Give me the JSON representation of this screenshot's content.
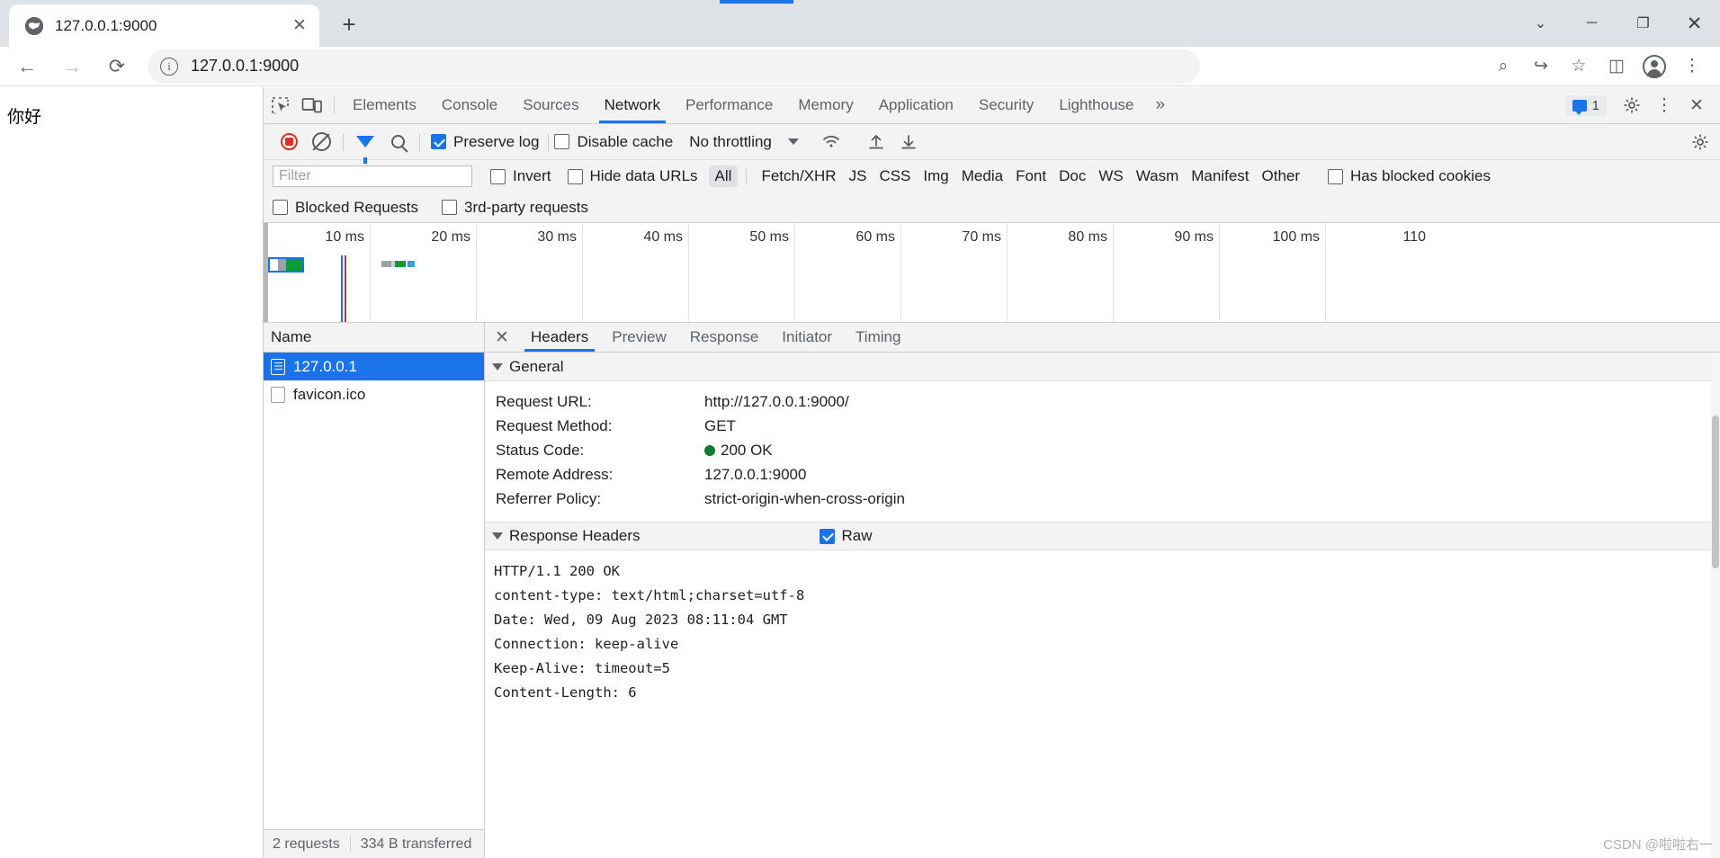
{
  "browser": {
    "tab": {
      "title": "127.0.0.1:9000",
      "favicon": "globe-icon",
      "close": "✕"
    },
    "new_tab": "+",
    "window_controls": {
      "expand": "⌄",
      "minimize": "─",
      "maximize": "❐",
      "close": "✕"
    },
    "nav": {
      "back": "←",
      "forward": "→",
      "reload": "⟳"
    },
    "omnibox": {
      "info": "i",
      "url": "127.0.0.1:9000"
    },
    "toolbar_right": {
      "zoom": "⌕",
      "share": "↪",
      "bookmark": "☆",
      "sidepanel": "◫",
      "menu": "⋮"
    }
  },
  "page": {
    "body_text": "你好"
  },
  "devtools": {
    "header": {
      "inspect_icon": "inspect-element-icon",
      "device_icon": "device-toolbar-icon",
      "tabs": [
        {
          "label": "Elements",
          "active": false
        },
        {
          "label": "Console",
          "active": false
        },
        {
          "label": "Sources",
          "active": false
        },
        {
          "label": "Network",
          "active": true
        },
        {
          "label": "Performance",
          "active": false
        },
        {
          "label": "Memory",
          "active": false
        },
        {
          "label": "Application",
          "active": false
        },
        {
          "label": "Security",
          "active": false
        },
        {
          "label": "Lighthouse",
          "active": false
        }
      ],
      "more": "»",
      "message_count": "1",
      "settings_icon": "gear-icon",
      "menu_icon": "kebab-menu-icon",
      "close_icon": "close-icon"
    },
    "toolbar": {
      "record_label": "record-button",
      "clear_label": "clear-button",
      "filter_label": "filter-toggle",
      "search_label": "search-button",
      "preserve_log": {
        "label": "Preserve log",
        "checked": true
      },
      "disable_cache": {
        "label": "Disable cache",
        "checked": false
      },
      "throttling": "No throttling",
      "wifi_icon": "network-conditions-icon",
      "import_icon": "import-har-icon",
      "export_icon": "export-har-icon",
      "settings_icon": "network-settings-icon"
    },
    "filterbar": {
      "filter_placeholder": "Filter",
      "filter_value": "",
      "invert": {
        "label": "Invert",
        "checked": false
      },
      "hide_data_urls": {
        "label": "Hide data URLs",
        "checked": false
      },
      "types": [
        {
          "label": "All",
          "active": true
        },
        {
          "label": "Fetch/XHR",
          "active": false
        },
        {
          "label": "JS",
          "active": false
        },
        {
          "label": "CSS",
          "active": false
        },
        {
          "label": "Img",
          "active": false
        },
        {
          "label": "Media",
          "active": false
        },
        {
          "label": "Font",
          "active": false
        },
        {
          "label": "Doc",
          "active": false
        },
        {
          "label": "WS",
          "active": false
        },
        {
          "label": "Wasm",
          "active": false
        },
        {
          "label": "Manifest",
          "active": false
        },
        {
          "label": "Other",
          "active": false
        }
      ],
      "has_blocked_cookies": {
        "label": "Has blocked cookies",
        "checked": false
      },
      "blocked_requests": {
        "label": "Blocked Requests",
        "checked": false
      },
      "third_party": {
        "label": "3rd-party requests",
        "checked": false
      }
    },
    "overview": {
      "ticks": [
        "10 ms",
        "20 ms",
        "30 ms",
        "40 ms",
        "50 ms",
        "60 ms",
        "70 ms",
        "80 ms",
        "90 ms",
        "100 ms",
        "110"
      ]
    },
    "requests": {
      "column_header": "Name",
      "rows": [
        {
          "name": "127.0.0.1",
          "icon": "document-icon",
          "selected": true
        },
        {
          "name": "favicon.ico",
          "icon": "generic-file-icon",
          "selected": false
        }
      ]
    },
    "status_bar": {
      "requests": "2 requests",
      "transferred": "334 B transferred"
    },
    "detail": {
      "close_icon": "✕",
      "tabs": [
        {
          "label": "Headers",
          "active": true
        },
        {
          "label": "Preview",
          "active": false
        },
        {
          "label": "Response",
          "active": false
        },
        {
          "label": "Initiator",
          "active": false
        },
        {
          "label": "Timing",
          "active": false
        }
      ],
      "general": {
        "title": "General",
        "rows": [
          {
            "key": "Request URL:",
            "value": "http://127.0.0.1:9000/",
            "dot": false
          },
          {
            "key": "Request Method:",
            "value": "GET",
            "dot": false
          },
          {
            "key": "Status Code:",
            "value": "200 OK",
            "dot": true
          },
          {
            "key": "Remote Address:",
            "value": "127.0.0.1:9000",
            "dot": false
          },
          {
            "key": "Referrer Policy:",
            "value": "strict-origin-when-cross-origin",
            "dot": false
          }
        ]
      },
      "response_headers": {
        "title": "Response Headers",
        "raw": {
          "label": "Raw",
          "checked": true
        },
        "lines": [
          "HTTP/1.1 200 OK",
          "content-type: text/html;charset=utf-8",
          "Date: Wed, 09 Aug 2023 08:11:04 GMT",
          "Connection: keep-alive",
          "Keep-Alive: timeout=5",
          "Content-Length: 6"
        ]
      }
    }
  },
  "watermark": "CSDN @啦啦右一",
  "colors": {
    "accent": "#1a73e8",
    "record": "#d93025",
    "status_ok": "#0d7c2f",
    "chrome_bg": "#dee1e6",
    "panel_bg": "#f3f3f3"
  }
}
